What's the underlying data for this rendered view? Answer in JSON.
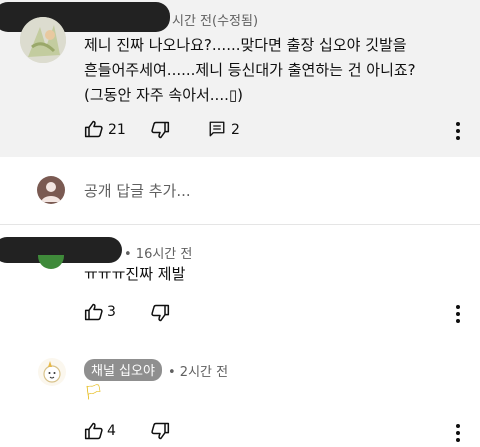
{
  "comment1": {
    "time_text": "시간 전(수정됨)",
    "lines": [
      "제니 진짜 나오나요?......맞다면 출장 십오야 깃발을",
      "흔들어주세여......제니 등신대가 출연하는 건 아니죠?",
      "(그동안 자주 속아서....▯)"
    ],
    "likes": "21",
    "replies": "2",
    "icons": {
      "like": "thumb-up-icon",
      "dislike": "thumb-down-icon",
      "reply": "comment-icon",
      "more": "more-vert-icon"
    }
  },
  "reply_box": {
    "placeholder": "공개 답글 추가..."
  },
  "comment2": {
    "time_text": "• 16시간 전",
    "text": "ㅠㅠㅠ진짜 제발",
    "likes": "3"
  },
  "comment3": {
    "channel_name": "채널 십오야",
    "time_text": "• 2시간 전",
    "text": "🏳",
    "likes": "4"
  },
  "colors": {
    "top_bg": "#f2f2f2",
    "chip_bg": "#8f8f8f",
    "text": "#0f0f0f",
    "meta": "#606060",
    "redaction": "#222222"
  }
}
